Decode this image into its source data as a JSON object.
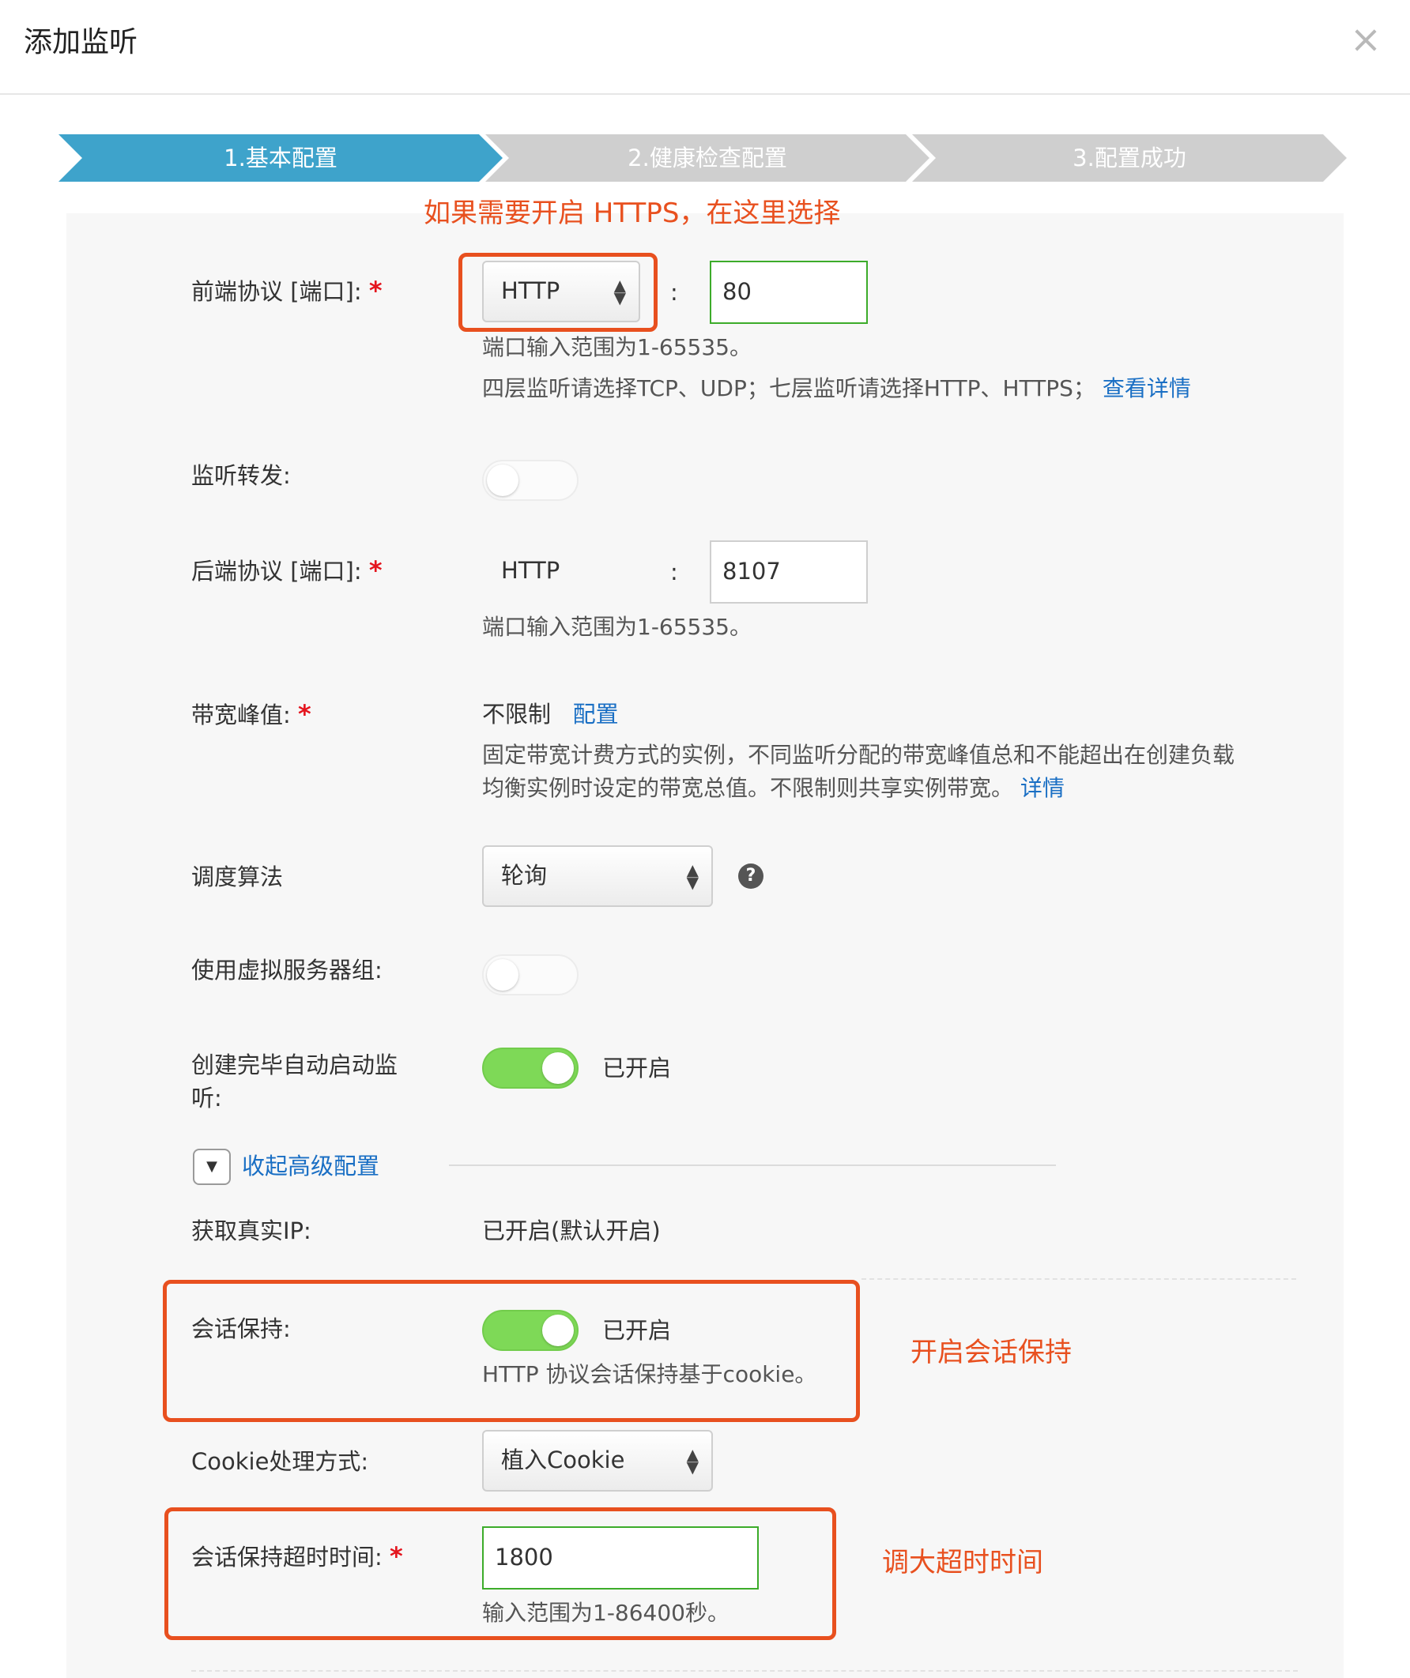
{
  "dialog": {
    "title": "添加监听"
  },
  "steps": [
    {
      "label": "1.基本配置",
      "active": true
    },
    {
      "label": "2.健康检查配置",
      "active": false
    },
    {
      "label": "3.配置成功",
      "active": false
    }
  ],
  "colors": {
    "active_step": "#3ea3cb",
    "inactive_step": "#cfcfcf",
    "annotation": "#e8501f",
    "link": "#1a6fc4",
    "toggle_on": "#7ed957",
    "required": "#e4151e"
  },
  "annotations": {
    "https": "如果需要开启 HTTPS，在这里选择",
    "session": "开启会话保持",
    "timeout": "调大超时时间"
  },
  "form": {
    "required_mark": "*",
    "port_sep": ":",
    "frontend": {
      "label": "前端协议 [端口]:",
      "protocol": "HTTP",
      "port": "80",
      "hint1": "端口输入范围为1-65535。",
      "hint2": "四层监听请选择TCP、UDP；七层监听请选择HTTP、HTTPS；",
      "hint2_link": "查看详情"
    },
    "forwarding": {
      "label": "监听转发:",
      "enabled": false
    },
    "backend": {
      "label": "后端协议 [端口]:",
      "protocol": "HTTP",
      "port": "8107",
      "hint": "端口输入范围为1-65535。"
    },
    "bandwidth": {
      "label": "带宽峰值:",
      "value": "不限制",
      "config_link": "配置",
      "desc1": "固定带宽计费方式的实例，不同监听分配的带宽峰值总和不能超出在创建负载",
      "desc2": "均衡实例时设定的带宽总值。不限制则共享实例带宽。",
      "detail_link": "详情"
    },
    "scheduler": {
      "label": "调度算法",
      "value": "轮询",
      "help_icon": "?"
    },
    "vserver_group": {
      "label": "使用虚拟服务器组:",
      "enabled": false
    },
    "auto_start": {
      "label_line1": "创建完毕自动启动监",
      "label_line2": "听:",
      "enabled": true,
      "status": "已开启"
    },
    "advanced": {
      "toggle_label": "收起高级配置",
      "toggle_icon": "▼"
    },
    "real_ip": {
      "label": "获取真实IP:",
      "value": "已开启(默认开启)"
    },
    "session": {
      "label": "会话保持:",
      "enabled": true,
      "status": "已开启",
      "hint": "HTTP 协议会话保持基于cookie。"
    },
    "cookie": {
      "label": "Cookie处理方式:",
      "value": "植入Cookie"
    },
    "timeout": {
      "label": "会话保持超时时间:",
      "value": "1800",
      "hint": "输入范围为1-86400秒。"
    }
  },
  "icons": {
    "close": "close-icon",
    "select_arrows": "updown-arrows-icon",
    "help": "question-icon",
    "collapse": "chevron-down-icon"
  }
}
